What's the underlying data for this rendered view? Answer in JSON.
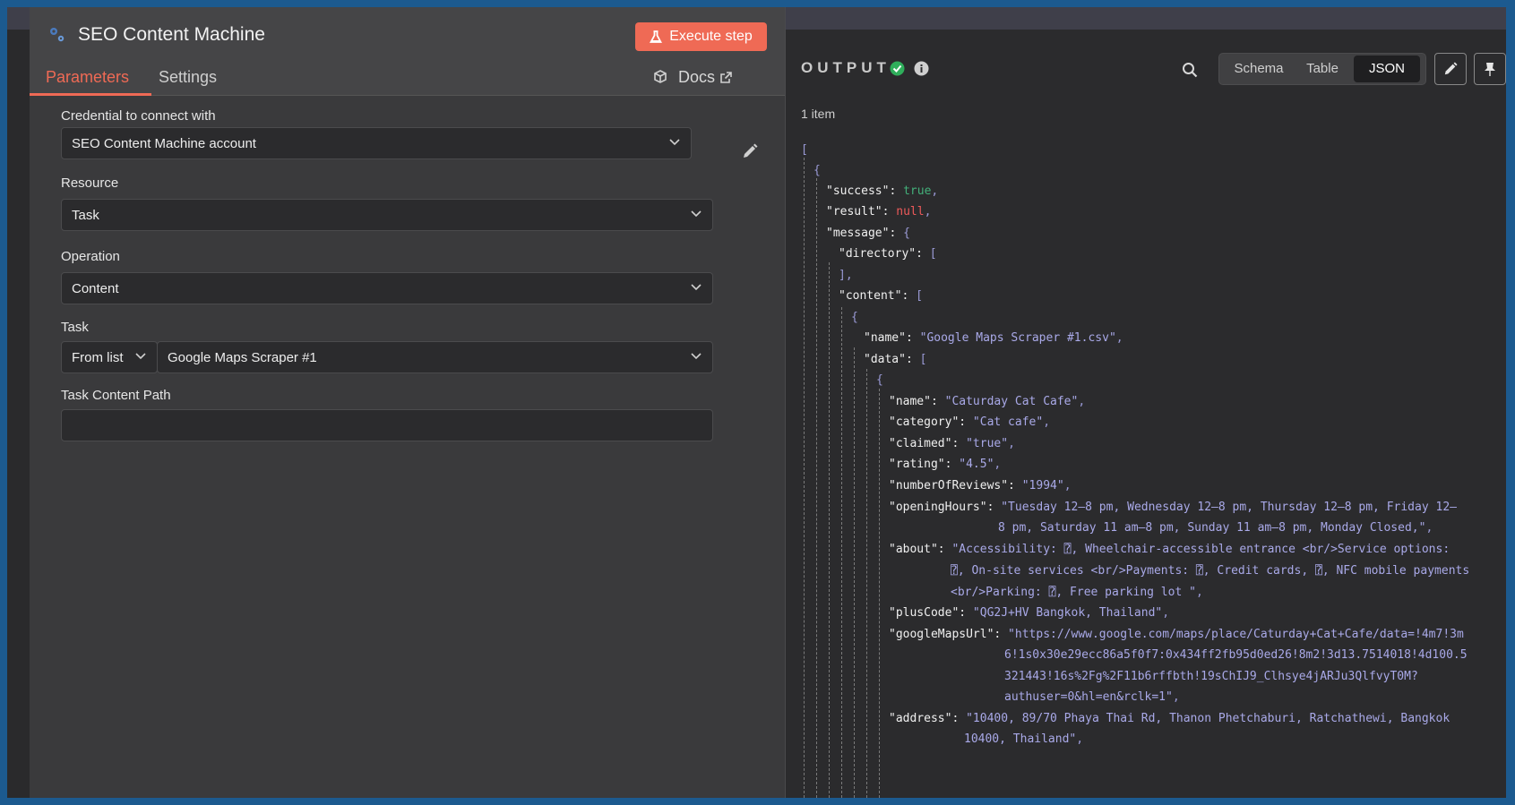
{
  "node": {
    "title": "SEO Content Machine",
    "execute_label": "Execute step",
    "tabs": [
      "Parameters",
      "Settings"
    ],
    "docs_label": "Docs"
  },
  "form": {
    "credential": {
      "label": "Credential to connect with",
      "value": "SEO Content Machine account"
    },
    "resource": {
      "label": "Resource",
      "value": "Task"
    },
    "operation": {
      "label": "Operation",
      "value": "Content"
    },
    "task": {
      "label": "Task",
      "mode": "From list",
      "value": "Google Maps Scraper #1"
    },
    "task_content_path": {
      "label": "Task Content Path",
      "value": ""
    }
  },
  "output": {
    "title": "OUTPUT",
    "views": [
      "Schema",
      "Table",
      "JSON"
    ],
    "active_view": "JSON",
    "count": "1 item",
    "lines": [
      [
        "["
      ],
      [
        "{"
      ],
      [
        "\"success\":",
        " true",
        ","
      ],
      [
        "\"result\":",
        " null",
        ","
      ],
      [
        "\"message\":",
        " {"
      ],
      [
        "\"directory\":",
        " ["
      ],
      [
        "],"
      ],
      [
        "\"content\":",
        " ["
      ],
      [
        "{"
      ],
      [
        "\"name\":",
        " \"Google Maps Scraper #1.csv\"",
        ","
      ],
      [
        "\"data\":",
        " ["
      ],
      [
        "{"
      ],
      [
        "\"name\":",
        " \"Caturday Cat Cafe\"",
        ","
      ],
      [
        "\"category\":",
        " \"Cat cafe\"",
        ","
      ],
      [
        "\"claimed\":",
        " \"true\"",
        ","
      ],
      [
        "\"rating\":",
        " \"4.5\"",
        ","
      ],
      [
        "\"numberOfReviews\":",
        " \"1994\"",
        ","
      ],
      [
        "\"openingHours\":",
        " \"Tuesday 12–8 pm, Wednesday 12–8 pm, Thursday 12–8 pm, Friday 12–",
        ""
      ],
      [
        "",
        "8 pm, Saturday 11 am–8 pm, Sunday 11 am–8 pm, Monday Closed,\"",
        ","
      ],
      [
        "\"about\":",
        " \"Accessibility: ⍰, Wheelchair-accessible entrance <br/>Service options:",
        ""
      ],
      [
        "",
        "⍰, On-site services <br/>Payments: ⍰, Credit cards, ⍰, NFC mobile payments",
        ""
      ],
      [
        "",
        "<br/>Parking: ⍰, Free parking lot \"",
        ","
      ],
      [
        "\"plusCode\":",
        " \"QG2J+HV Bangkok, Thailand\"",
        ","
      ],
      [
        "\"googleMapsUrl\":",
        " \"https://www.google.com/maps/place/Caturday+Cat+Cafe/data=!4m7!3m",
        ""
      ],
      [
        "",
        "6!1s0x30e29ecc86a5f0f7:0x434ff2fb95d0ed26!8m2!3d13.7514018!4d100.5",
        ""
      ],
      [
        "",
        "321443!16s%2Fg%2F11b6rffbth!19sChIJ9_Clhsye4jARJu3QlfvyT0M?",
        ""
      ],
      [
        "",
        "authuser=0&hl=en&rclk=1\"",
        ","
      ],
      [
        "\"address\":",
        " \"10400, 89/70 Phaya Thai Rd, Thanon Phetchaburi, Ratchathewi, Bangkok",
        ""
      ],
      [
        "",
        "10400, Thailand\"",
        ","
      ]
    ]
  },
  "colors": {
    "accent": "#ef6a55",
    "success": "#2fae5b"
  }
}
